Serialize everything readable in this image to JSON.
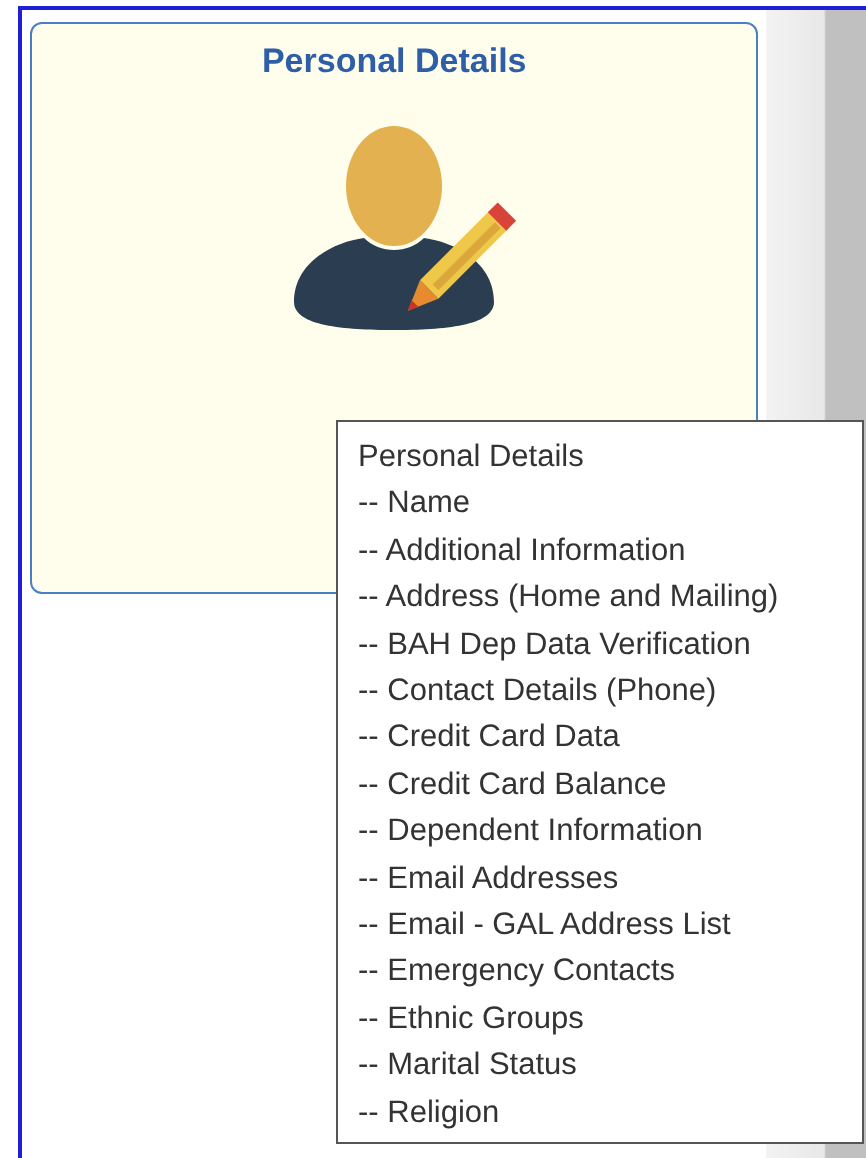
{
  "tile": {
    "title": "Personal Details"
  },
  "tooltip": {
    "title": "Personal Details",
    "items": [
      "-- Name",
      "-- Additional Information",
      "-- Address (Home and Mailing)",
      "-- BAH Dep Data Verification",
      "-- Contact Details (Phone)",
      "-- Credit Card Data",
      "-- Credit Card Balance",
      "-- Dependent Information",
      "-- Email Addresses",
      "-- Email - GAL Address List",
      "-- Emergency Contacts",
      "-- Ethnic Groups",
      "-- Marital Status",
      "-- Religion"
    ]
  }
}
